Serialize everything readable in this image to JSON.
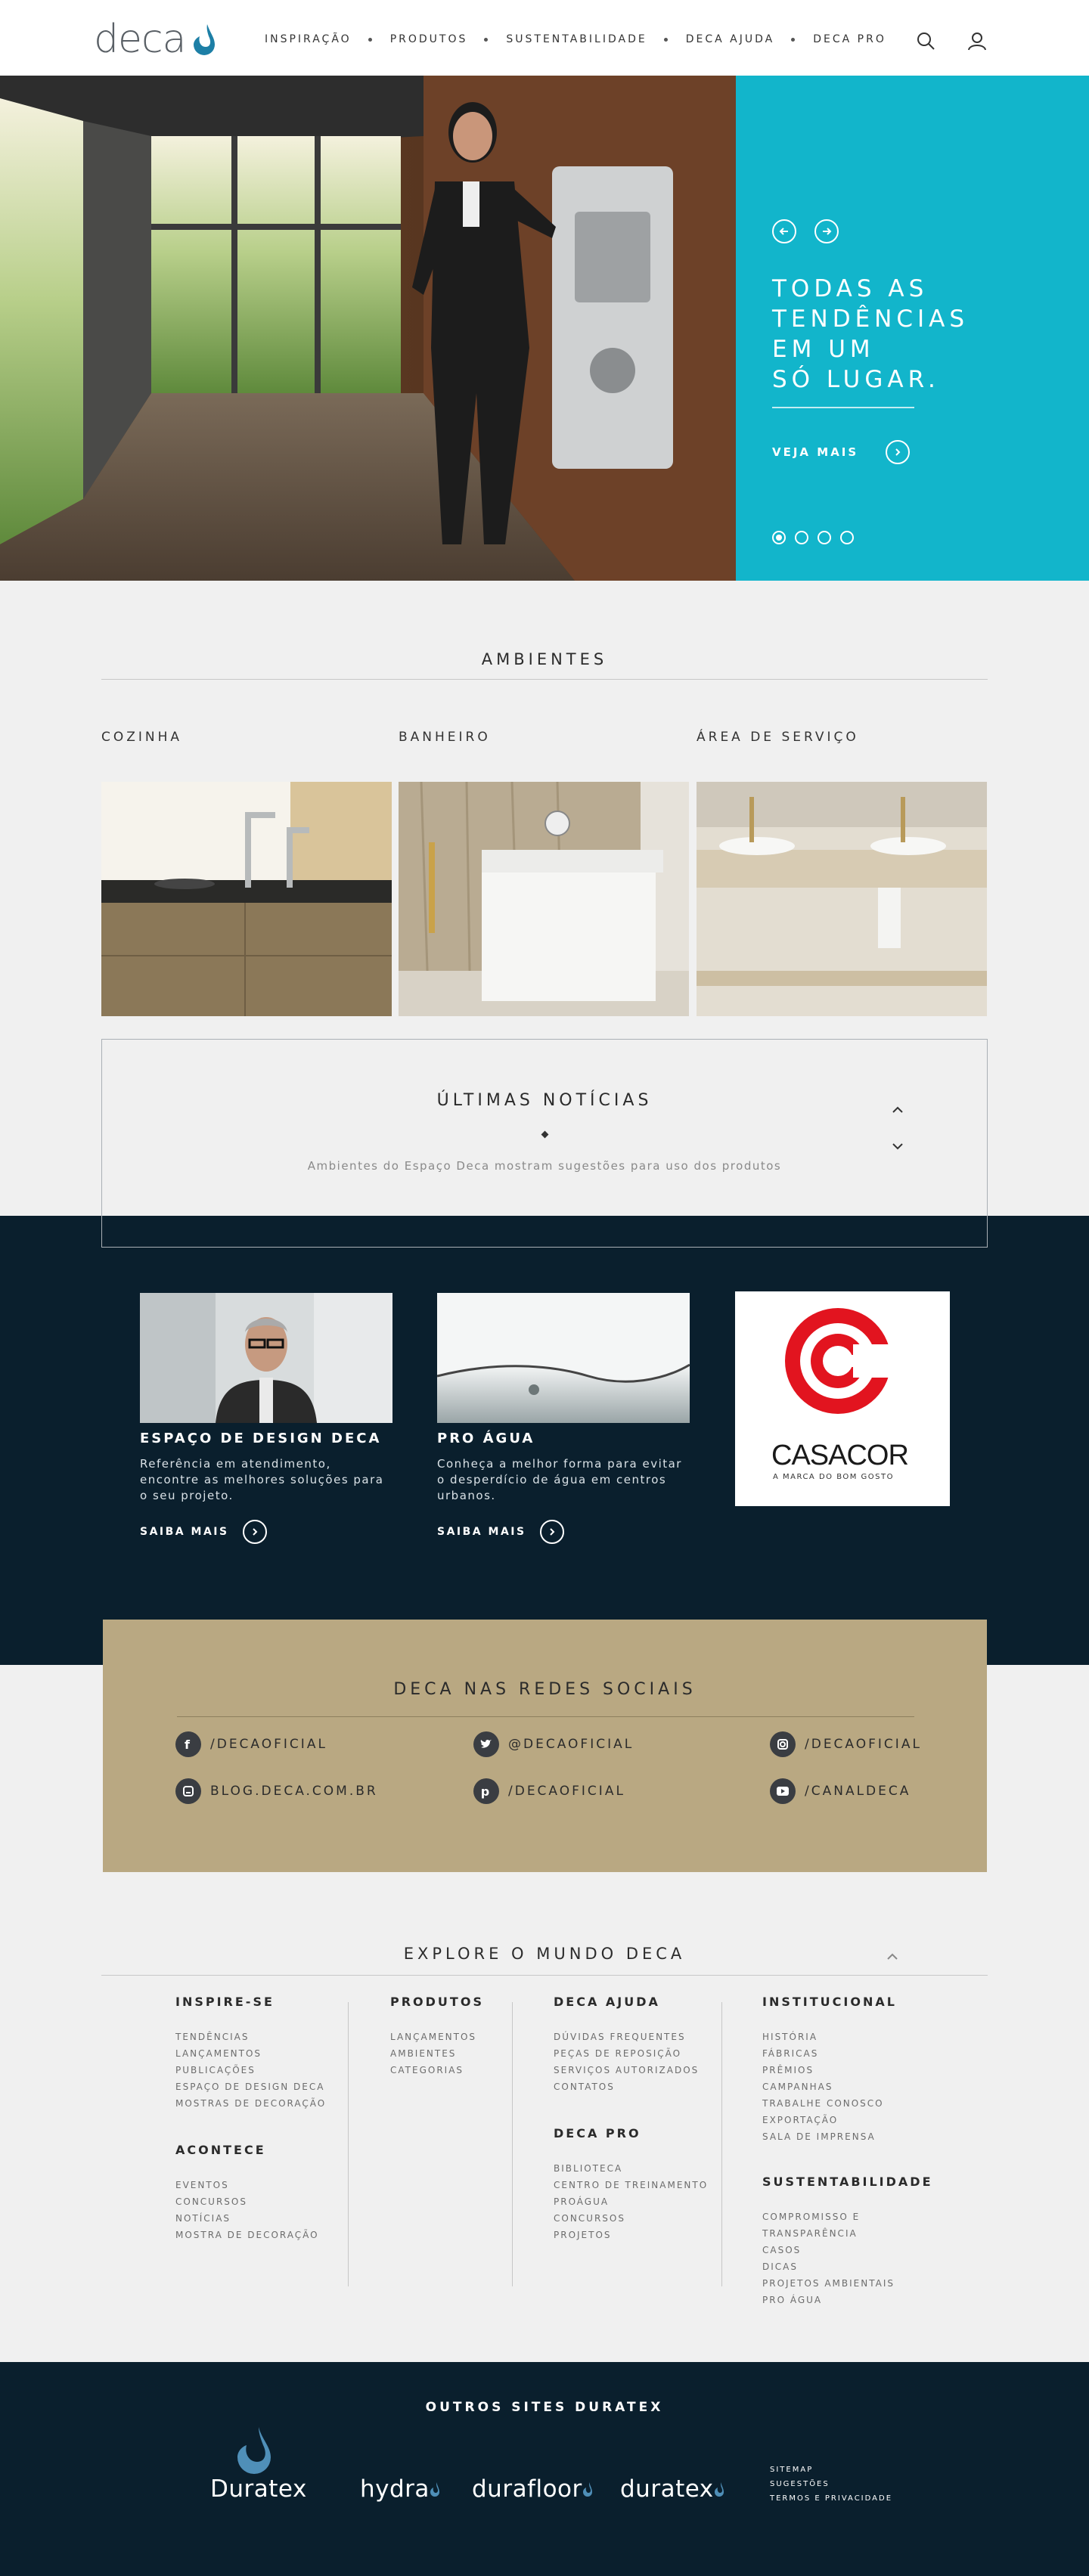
{
  "header": {
    "logo": "deca",
    "nav": [
      "INSPIRAÇÃO",
      "PRODUTOS",
      "SUSTENTABILIDADE",
      "DECA AJUDA",
      "DECA PRO"
    ]
  },
  "hero": {
    "title_lines": [
      "TODAS AS",
      "TENDÊNCIAS",
      "EM UM",
      "SÓ LUGAR."
    ],
    "link": "VEJA MAIS",
    "slide_count": 4,
    "active_slide": 1
  },
  "ambientes": {
    "title": "AMBIENTES",
    "items": [
      {
        "label": "COZINHA"
      },
      {
        "label": "BANHEIRO"
      },
      {
        "label": "ÁREA DE SERVIÇO"
      }
    ]
  },
  "news": {
    "title": "ÚLTIMAS NOTÍCIAS",
    "text": "Ambientes do Espaço Deca mostram sugestões para uso dos produtos"
  },
  "cards": [
    {
      "title": "ESPAÇO DE DESIGN DECA",
      "text": "Referência em atendimento, encontre as melhores soluções para o seu projeto.",
      "link": "SAIBA MAIS"
    },
    {
      "title": "PRO ÁGUA",
      "text": "Conheça a melhor forma para evitar o desperdício de água em centros urbanos.",
      "link": "SAIBA MAIS"
    }
  ],
  "casacor": {
    "name": "CASACOR",
    "tagline": "A MARCA DO BOM GOSTO"
  },
  "social": {
    "title": "DECA NAS REDES SOCIAIS",
    "items": [
      {
        "label": "/DECAOFICIAL",
        "icon": "facebook-icon"
      },
      {
        "label": "@DECAOFICIAL",
        "icon": "twitter-icon"
      },
      {
        "label": "/DECAOFICIAL",
        "icon": "instagram-icon"
      },
      {
        "label": "BLOG.DECA.COM.BR",
        "icon": "blog-icon"
      },
      {
        "label": "/DECAOFICIAL",
        "icon": "pinterest-icon"
      },
      {
        "label": "/CANALDECA",
        "icon": "youtube-icon"
      }
    ]
  },
  "explore": {
    "title": "EXPLORE O MUNDO DECA",
    "columns": {
      "inspire": {
        "title": "INSPIRE-SE",
        "items": [
          "TENDÊNCIAS",
          "LANÇAMENTOS",
          "PUBLICAÇÕES",
          "ESPAÇO DE DESIGN DECA",
          "MOSTRAS DE DECORAÇÃO"
        ]
      },
      "acontece": {
        "title": "ACONTECE",
        "items": [
          "EVENTOS",
          "CONCURSOS",
          "NOTÍCIAS",
          "MOSTRA DE DECORAÇÃO"
        ]
      },
      "produtos": {
        "title": "PRODUTOS",
        "items": [
          "LANÇAMENTOS",
          "AMBIENTES",
          "CATEGORIAS"
        ]
      },
      "ajuda": {
        "title": "DECA AJUDA",
        "items": [
          "DÚVIDAS FREQUENTES",
          "PEÇAS DE REPOSIÇÃO",
          "SERVIÇOS AUTORIZADOS",
          "CONTATOS"
        ]
      },
      "pro": {
        "title": "DECA PRO",
        "items": [
          "BIBLIOTECA",
          "CENTRO DE TREINAMENTO",
          "PROÁGUA",
          "CONCURSOS",
          "PROJETOS"
        ]
      },
      "institucional": {
        "title": "INSTITUCIONAL",
        "items": [
          "HISTÓRIA",
          "FÁBRICAS",
          "PRÊMIOS",
          "CAMPANHAS",
          "TRABALHE CONOSCO",
          "EXPORTAÇÃO",
          "SALA DE IMPRENSA"
        ]
      },
      "sustentabilidade": {
        "title": "SUSTENTABILIDADE",
        "items": [
          "COMPROMISSO E",
          "TRANSPARÊNCIA",
          "CASOS",
          "DICAS",
          "PROJETOS AMBIENTAIS",
          "PRO ÁGUA"
        ]
      }
    }
  },
  "footer": {
    "title": "OUTROS SITES DURATEX",
    "brands": [
      "Duratex",
      "hydra",
      "durafloor",
      "duratex"
    ],
    "links": [
      "SITEMAP",
      "SUGESTÕES",
      "TERMOS E PRIVACIDADE"
    ]
  },
  "colors": {
    "accent": "#12b5cb",
    "dark": "#0a1f2d",
    "sand": "#b9a882",
    "casacor_red": "#e2141f"
  }
}
